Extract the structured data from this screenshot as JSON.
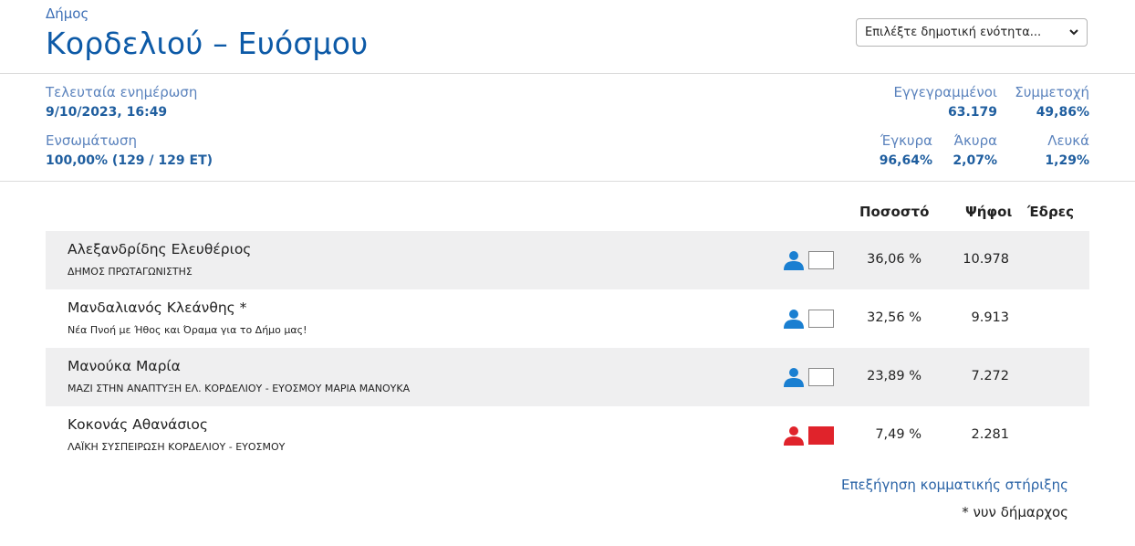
{
  "header": {
    "subtitle": "Δήμος",
    "title": "Κορδελιού – Ευόσμου",
    "unit_select": {
      "value": "Επιλέξτε δημοτική ενότητα..."
    }
  },
  "stats": {
    "last_update_label": "Τελευταία ενημέρωση",
    "last_update_value": "9/10/2023, 16:49",
    "integration_label": "Ενσωμάτωση",
    "integration_value": "100,00% (129 / 129 ΕΤ)",
    "registered_label": "Εγγεγραμμένοι",
    "registered_value": "63.179",
    "turnout_label": "Συμμετοχή",
    "turnout_value": "49,86%",
    "valid_label": "Έγκυρα",
    "valid_value": "96,64%",
    "invalid_label": "Άκυρα",
    "invalid_value": "2,07%",
    "blank_label": "Λευκά",
    "blank_value": "1,29%"
  },
  "table": {
    "headers": {
      "percent": "Ποσοστό",
      "votes": "Ψήφοι",
      "seats": "Έδρες"
    },
    "rows": [
      {
        "name": "Αλεξανδρίδης Ελευθέριος",
        "party": "ΔΗΜΟΣ ΠΡΩΤΑΓΩΝΙΣΤΗΣ",
        "percent": "36,06 %",
        "votes": "10.978",
        "seats": "",
        "icon_color": "#1a7fd1",
        "party_color": "#ffffff"
      },
      {
        "name": "Μανδαλιανός Κλεάνθης *",
        "party": "Νέα Πνοή με Ήθος και Όραμα για το Δήμο μας!",
        "percent": "32,56 %",
        "votes": "9.913",
        "seats": "",
        "icon_color": "#1a7fd1",
        "party_color": "#ffffff"
      },
      {
        "name": "Μανούκα Μαρία",
        "party": "ΜΑΖΙ ΣΤΗΝ ΑΝΑΠΤΥΞΗ ΕΛ. ΚΟΡΔΕΛΙΟΥ - ΕΥΟΣΜΟΥ ΜΑΡΙΑ ΜΑΝΟΥΚΑ",
        "percent": "23,89 %",
        "votes": "7.272",
        "seats": "",
        "icon_color": "#1a7fd1",
        "party_color": "#ffffff"
      },
      {
        "name": "Κοκονάς Αθανάσιος",
        "party": "ΛΑΪΚΗ ΣΥΣΠΕΙΡΩΣΗ ΚΟΡΔΕΛΙΟΥ - ΕΥΟΣΜΟΥ",
        "percent": "7,49 %",
        "votes": "2.281",
        "seats": "",
        "icon_color": "#e0232b",
        "party_color": "#e0232b"
      }
    ]
  },
  "footer": {
    "explain_link": "Επεξήγηση κομματικής στήριξης",
    "footnote": "* νυν δήμαρχος"
  }
}
